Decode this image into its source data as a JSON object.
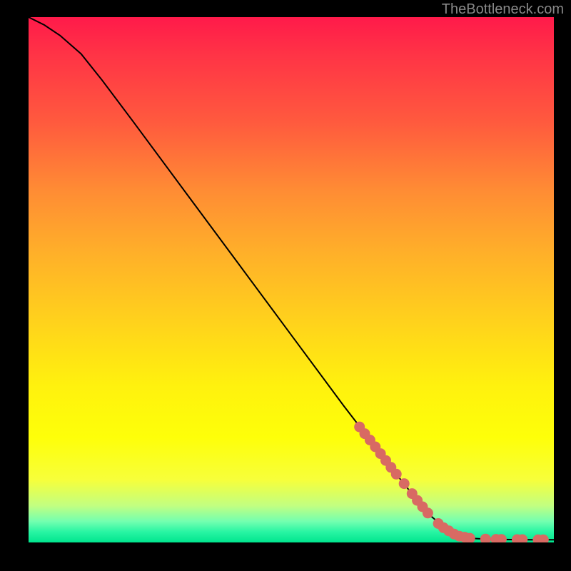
{
  "watermark": "TheBottleneck.com",
  "chart_data": {
    "type": "line",
    "title": "",
    "xlabel": "",
    "ylabel": "",
    "xlim": [
      0,
      100
    ],
    "ylim": [
      0,
      100
    ],
    "curve": [
      {
        "x": 0,
        "y": 100
      },
      {
        "x": 3,
        "y": 98.5
      },
      {
        "x": 6,
        "y": 96.5
      },
      {
        "x": 10,
        "y": 93
      },
      {
        "x": 14,
        "y": 88
      },
      {
        "x": 20,
        "y": 80
      },
      {
        "x": 30,
        "y": 66.5
      },
      {
        "x": 40,
        "y": 53
      },
      {
        "x": 50,
        "y": 39.5
      },
      {
        "x": 60,
        "y": 26
      },
      {
        "x": 70,
        "y": 13
      },
      {
        "x": 76,
        "y": 5.5
      },
      {
        "x": 80,
        "y": 2.2
      },
      {
        "x": 82,
        "y": 1.2
      },
      {
        "x": 84,
        "y": 0.8
      },
      {
        "x": 88,
        "y": 0.6
      },
      {
        "x": 92,
        "y": 0.55
      },
      {
        "x": 96,
        "y": 0.5
      },
      {
        "x": 100,
        "y": 0.5
      }
    ],
    "markers": [
      {
        "x": 63,
        "y": 22
      },
      {
        "x": 64,
        "y": 20.7
      },
      {
        "x": 65,
        "y": 19.5
      },
      {
        "x": 66,
        "y": 18.2
      },
      {
        "x": 67,
        "y": 16.9
      },
      {
        "x": 68,
        "y": 15.6
      },
      {
        "x": 69,
        "y": 14.3
      },
      {
        "x": 70,
        "y": 13.0
      },
      {
        "x": 71.5,
        "y": 11.2
      },
      {
        "x": 73,
        "y": 9.3
      },
      {
        "x": 74,
        "y": 8.0
      },
      {
        "x": 75,
        "y": 6.8
      },
      {
        "x": 76,
        "y": 5.6
      },
      {
        "x": 78,
        "y": 3.6
      },
      {
        "x": 79,
        "y": 2.8
      },
      {
        "x": 80,
        "y": 2.2
      },
      {
        "x": 81,
        "y": 1.6
      },
      {
        "x": 82,
        "y": 1.2
      },
      {
        "x": 83,
        "y": 1.0
      },
      {
        "x": 84,
        "y": 0.8
      },
      {
        "x": 87,
        "y": 0.65
      },
      {
        "x": 89,
        "y": 0.6
      },
      {
        "x": 90,
        "y": 0.58
      },
      {
        "x": 93,
        "y": 0.55
      },
      {
        "x": 94,
        "y": 0.55
      },
      {
        "x": 97,
        "y": 0.5
      },
      {
        "x": 98,
        "y": 0.5
      }
    ],
    "marker_color": "#d86a63"
  }
}
